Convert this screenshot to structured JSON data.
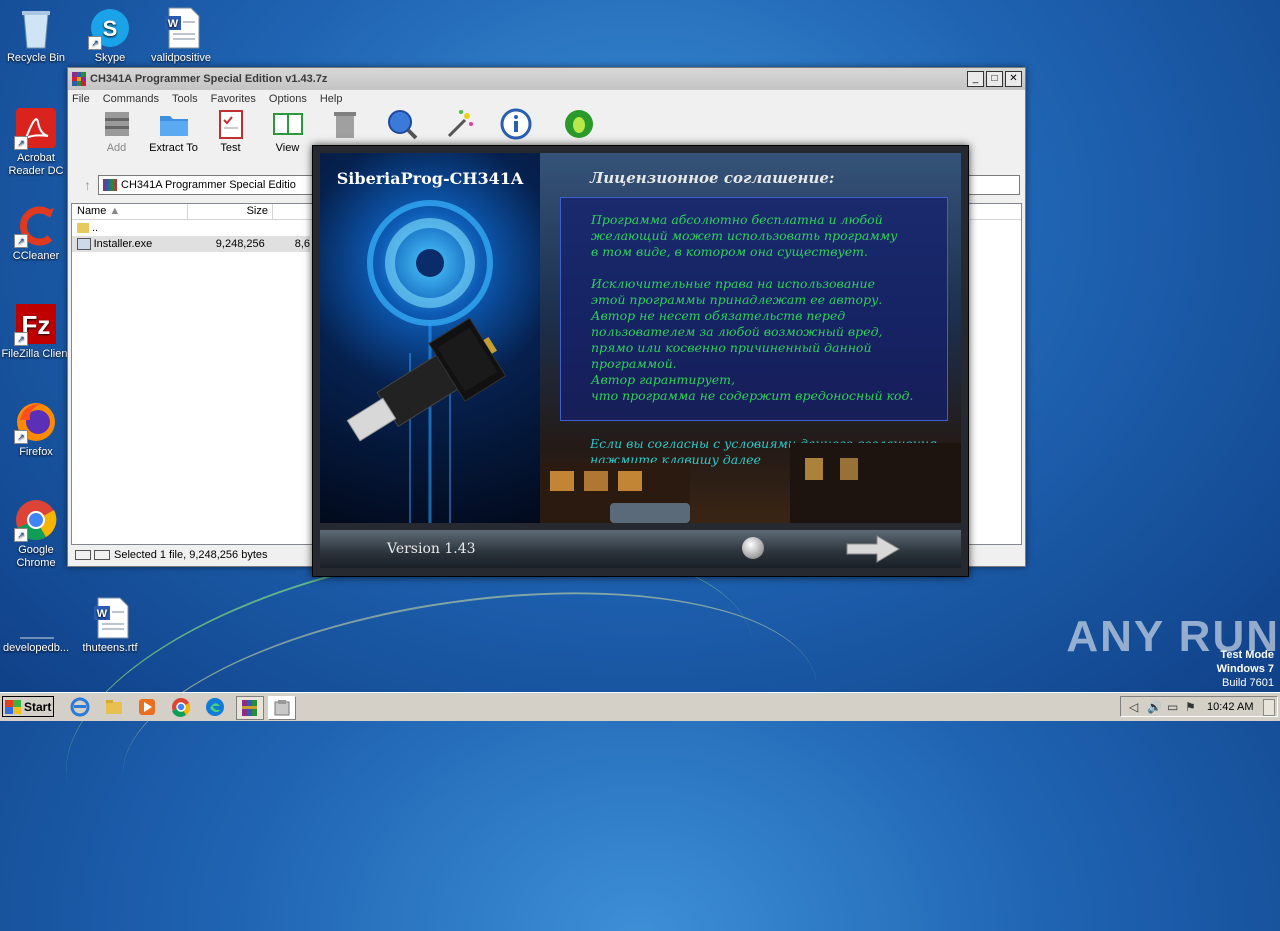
{
  "desktop": {
    "icons": [
      {
        "label": "Recycle Bin"
      },
      {
        "label": "Skype"
      },
      {
        "label": "validpositive"
      },
      {
        "label": "Acrobat Reader DC"
      },
      {
        "label": "CCleaner"
      },
      {
        "label": "FileZilla Client"
      },
      {
        "label": "Firefox"
      },
      {
        "label": "Google Chrome"
      },
      {
        "label": "developedb..."
      },
      {
        "label": "thuteens.rtf"
      }
    ]
  },
  "archiver": {
    "title": "CH341A Programmer Special Edition v1.43.7z",
    "menu": [
      "File",
      "Commands",
      "Tools",
      "Favorites",
      "Options",
      "Help"
    ],
    "toolbar": [
      {
        "label": "Add",
        "icon": "add-icon"
      },
      {
        "label": "Extract To",
        "icon": "extract-icon"
      },
      {
        "label": "Test",
        "icon": "test-icon"
      },
      {
        "label": "View",
        "icon": "view-icon"
      },
      {
        "label": "",
        "icon": "delete-icon"
      },
      {
        "label": "",
        "icon": "find-icon"
      },
      {
        "label": "",
        "icon": "wizard-icon"
      },
      {
        "label": "",
        "icon": "info-icon"
      },
      {
        "label": "",
        "icon": "virus-scan-icon"
      }
    ],
    "address": "CH341A Programmer Special Editio",
    "columns": {
      "name": "Name",
      "size": "Size"
    },
    "rows": [
      {
        "name": "..",
        "size": "",
        "packed": ""
      },
      {
        "name": "Installer.exe",
        "size": "9,248,256",
        "packed": "8,6"
      }
    ],
    "status": "Selected 1 file, 9,248,256 bytes"
  },
  "installer": {
    "brand": "SiberiaProg-CH341A",
    "heading": "Лицензионное соглашение:",
    "paragraphs": [
      [
        "Программа абсолютно бесплатна и любой",
        "желающий может использовать программу",
        "в том виде, в котором она существует."
      ],
      [
        "Исключительные права на использование",
        "этой программы принадлежат ее автору.",
        "Автор не несет обязательств перед",
        "пользователем за любой возможный вред,",
        "прямо или косвенно причиненный данной",
        "программой.",
        "Автор гарантирует,",
        "что программа не содержит вредоносный код."
      ]
    ],
    "agree": [
      "Если вы согласны с условиями данного соглашения",
      "нажмите клавишу далее"
    ],
    "version": "Version 1.43"
  },
  "taskbar": {
    "start": "Start",
    "clock": "10:42 AM"
  },
  "watermark": "ANY RUN",
  "test_mode": [
    "Test Mode",
    "Windows 7",
    "Build 7601"
  ],
  "colors": {
    "desktop": "#1f64b3",
    "license_text": "#2fd05a",
    "agree_text": "#2fc9c9"
  }
}
